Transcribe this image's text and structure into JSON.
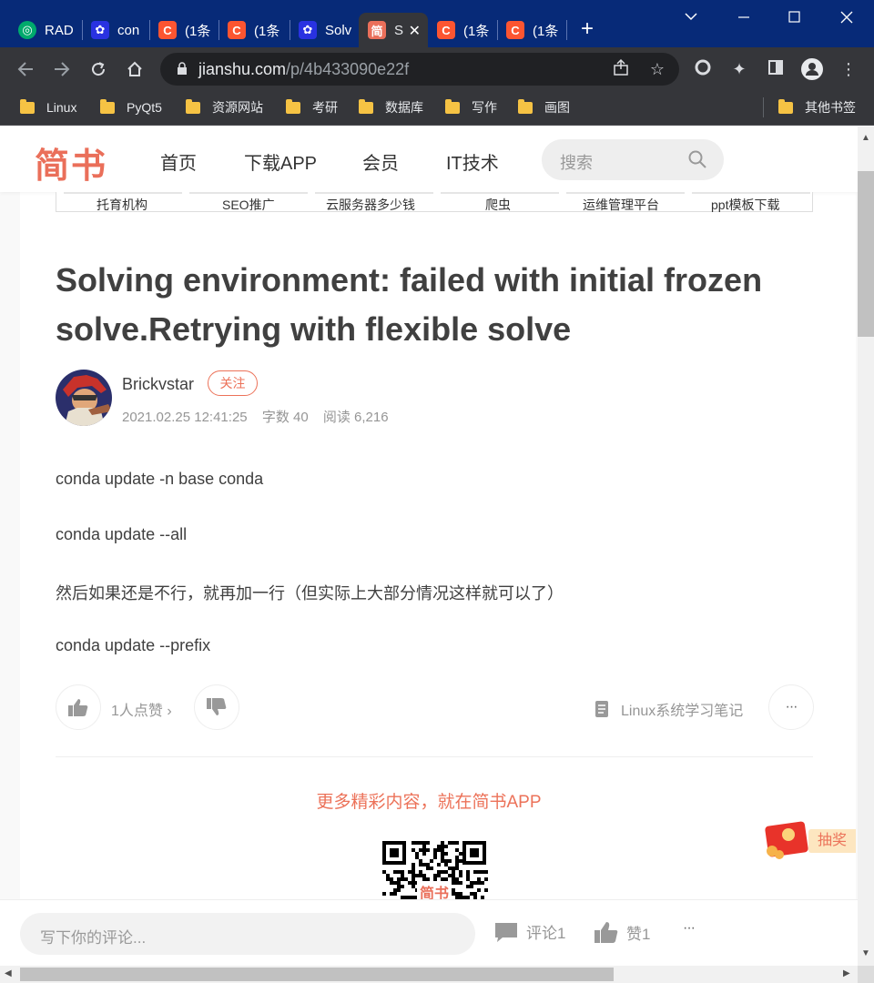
{
  "browser": {
    "tabs": [
      {
        "label": "RAD",
        "favicon": "tripadvisor-icon",
        "color": "#00aa6c"
      },
      {
        "label": "con",
        "favicon": "baidu-icon",
        "color": "#2932e1"
      },
      {
        "label": "(1条",
        "favicon": "csdn-icon",
        "color": "#fc5531"
      },
      {
        "label": "(1条",
        "favicon": "csdn-icon",
        "color": "#fc5531"
      },
      {
        "label": "Solv",
        "favicon": "baidu-icon",
        "color": "#2932e1"
      },
      {
        "label": "S",
        "favicon": "jianshu-icon",
        "color": "#ea6f5a",
        "favicon_text": "简"
      },
      {
        "label": "(1条",
        "favicon": "csdn-icon",
        "color": "#fc5531"
      },
      {
        "label": "(1条",
        "favicon": "csdn-icon",
        "color": "#fc5531"
      }
    ],
    "url_host": "jianshu.com",
    "url_path": "/p/4b433090e22f",
    "bookmarks": [
      "Linux",
      "PyQt5",
      "资源网站",
      "考研",
      "数据库",
      "写作",
      "画图"
    ],
    "other_bookmarks": "其他书签"
  },
  "site": {
    "logo": "简书",
    "nav": [
      "首页",
      "下载APP",
      "会员",
      "IT技术"
    ],
    "search_placeholder": "搜索",
    "ads": [
      "托育机构",
      "SEO推广",
      "云服务器多少钱",
      "爬虫",
      "运维管理平台",
      "ppt模板下载"
    ]
  },
  "article": {
    "title": "Solving environment: failed with initial frozen solve.Retrying with flexible solve",
    "author": "Brickvstar",
    "follow_label": "关注",
    "date": "2021.02.25 12:41:25",
    "word_count": "字数 40",
    "read_count": "阅读 6,216",
    "paragraphs": [
      "conda update -n base conda",
      "conda update --all",
      "然后如果还是不行，就再加一行（但实际上大部分情况这样就可以了）",
      "conda update --prefix"
    ],
    "likes_label": "1人点赞",
    "notebook": "Linux系统学习笔记",
    "more_label": "···"
  },
  "promo": {
    "text": "更多精彩内容，就在简书APP",
    "qr_label": "简书",
    "lottery": "抽奖"
  },
  "bottom": {
    "comment_placeholder": "写下你的评论...",
    "comments": "评论1",
    "likes": "赞1",
    "more": "···"
  }
}
